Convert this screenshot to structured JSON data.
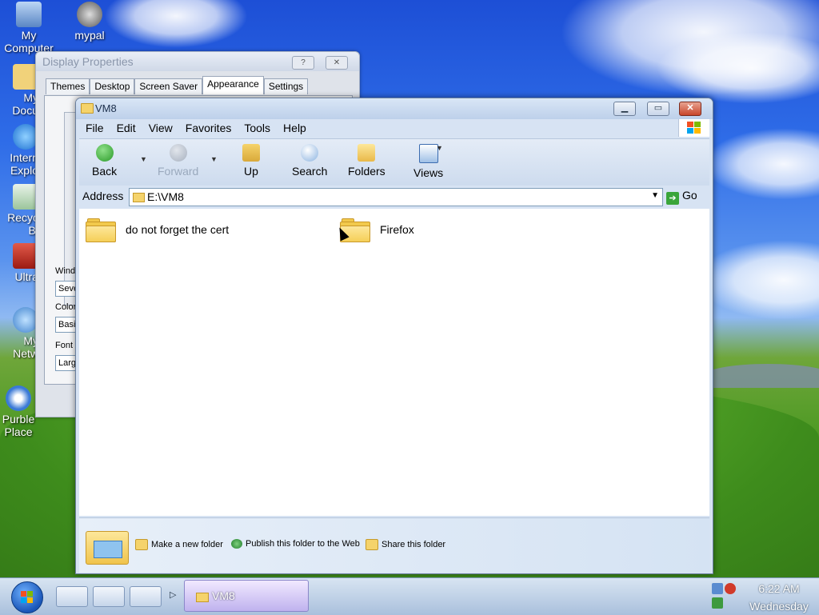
{
  "desktop": {
    "icons": [
      {
        "label": "My Computer",
        "lines": [
          "My",
          "Computer"
        ]
      },
      {
        "label": "mypal",
        "lines": [
          "mypal"
        ]
      },
      {
        "label": "My Documents",
        "lines": [
          "My",
          "Docu"
        ]
      },
      {
        "label": "Internet Explorer",
        "lines": [
          "Intern",
          "Explo"
        ]
      },
      {
        "label": "Recycle Bin",
        "lines": [
          "Recyc",
          "Bi"
        ]
      },
      {
        "label": "UltraISO",
        "lines": [
          "Ultra"
        ]
      },
      {
        "label": "My Network",
        "lines": [
          "My",
          "Netw"
        ]
      },
      {
        "label": "Purble Place",
        "lines": [
          "Purble",
          "Place"
        ]
      }
    ]
  },
  "display_properties": {
    "title": "Display Properties",
    "help_btn": "?",
    "close_btn": "✕",
    "tabs": [
      "Themes",
      "Desktop",
      "Screen Saver",
      "Appearance",
      "Settings"
    ],
    "active_tab": "Appearance",
    "fields": [
      {
        "label": "Wind",
        "value": "Seve"
      },
      {
        "label": "Color",
        "value": "Basic"
      },
      {
        "label": "Font s",
        "value": "Larg"
      }
    ]
  },
  "explorer": {
    "title": "VM8",
    "menu": [
      "File",
      "Edit",
      "View",
      "Favorites",
      "Tools",
      "Help"
    ],
    "toolbar": {
      "back": "Back",
      "forward": "Forward",
      "up": "Up",
      "search": "Search",
      "folders": "Folders",
      "views": "Views"
    },
    "address": {
      "label": "Address",
      "value": "E:\\VM8",
      "go": "Go"
    },
    "items": [
      {
        "name": "do not forget the cert"
      },
      {
        "name": "Firefox"
      }
    ],
    "tasks": {
      "new_folder": "Make a new folder",
      "publish": "Publish this folder to the Web",
      "share": "Share this folder"
    }
  },
  "taskbar": {
    "task_label": "VM8",
    "clock_time": "6:22 AM",
    "clock_day": "Wednesday"
  }
}
